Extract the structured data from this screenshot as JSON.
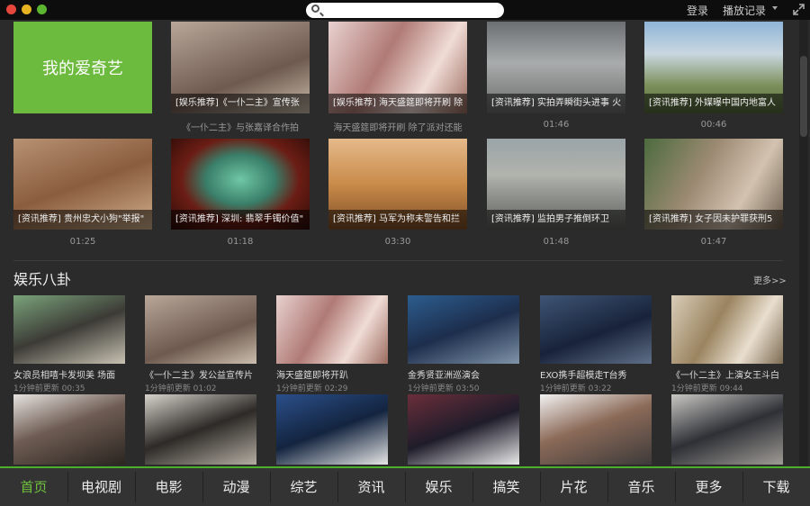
{
  "titlebar": {
    "search_placeholder": "",
    "login": "登录",
    "history": "播放记录"
  },
  "brand": {
    "label": "我的爱奇艺"
  },
  "row1": [
    {
      "caption": "[娱乐推荐]《一仆二主》宣传张",
      "meta": "《一仆二主》与张嘉译合作拍",
      "bg": "linear-gradient(160deg,#b9a79a,#6e5a4f 60%,#ccbfae)"
    },
    {
      "caption": "[娱乐推荐] 海天盛筵即将开刷 除",
      "meta": "海天盛筵即将开刷 除了派对还能",
      "bg": "linear-gradient(120deg,#e8d2d0,#b07a75 40%,#f0dcd6 70%,#9b6b5e)"
    },
    {
      "caption": "[资讯推荐] 实拍弄瞬街头进事 火",
      "meta": "01:46",
      "bg": "linear-gradient(180deg,#6b6f72,#a9acac 45%,#6a6b6a)"
    },
    {
      "caption": "[资讯推荐] 外媒曝中国内地富人",
      "meta": "00:46",
      "bg": "linear-gradient(180deg,#8fb5d8,#c9d7e0 35%,#7b8f5a 70%,#566a3c)"
    }
  ],
  "row2": [
    {
      "caption": "[资讯推荐] 贵州忠犬小狗\"举报\"",
      "meta": "01:25",
      "bg": "linear-gradient(160deg,#b79273,#8a5d3e 50%,#d1b08c)"
    },
    {
      "caption": "[资讯推荐] 深圳: 翡翠手镯价值\"",
      "meta": "01:18",
      "bg": "radial-gradient(ellipse at 50% 45%,#6fc7a5,#3a7e69 35%,#6b1d14 60%,#2a0b07)"
    },
    {
      "caption": "[资讯推荐] 马军为称未警告和拦",
      "meta": "03:30",
      "bg": "linear-gradient(180deg,#e5b98a,#c98b4a 50%,#7f4d25)"
    },
    {
      "caption": "[资讯推荐] 监拍男子推倒环卫",
      "meta": "01:48",
      "bg": "linear-gradient(180deg,#9aa4a8,#b1b3ad 40%,#5b5e5a)"
    },
    {
      "caption": "[资讯推荐] 女子因未护罪获刑5",
      "meta": "01:47",
      "bg": "linear-gradient(120deg,#4c6b3e,#9c8a73 40%,#d3c2b0 70%,#6a5c4b)"
    }
  ],
  "section": {
    "title": "娱乐八卦",
    "more": "更多>>"
  },
  "small_row1": [
    {
      "title": "女浪员相嘻卡发坝美 场面",
      "meta": "1分钟前更新 00:35",
      "bg": "linear-gradient(160deg,#7aa37a,#3c3b36 50%,#c8c2b2)"
    },
    {
      "title": "《一仆二主》发公益宣传片",
      "meta": "1分钟前更新 01:02",
      "bg": "linear-gradient(160deg,#b9a79a,#6e5a4f 60%,#ccbfae)"
    },
    {
      "title": "海天盛筵即将开趴",
      "meta": "1分钟前更新 02:29",
      "bg": "linear-gradient(120deg,#e8d2d0,#b07a75 40%,#f0dcd6 70%,#9b6b5e)"
    },
    {
      "title": "金秀贤亚洲巡演会",
      "meta": "1分钟前更新 03:50",
      "bg": "linear-gradient(160deg,#2c5d8e,#1d2e4d 50%,#7f93a8)"
    },
    {
      "title": "EXO携手超模走T台秀",
      "meta": "1分钟前更新 03:22",
      "bg": "linear-gradient(160deg,#3e5575,#18233a 55%,#5f6f88)"
    },
    {
      "title": "《一仆二主》上演女王斗白",
      "meta": "1分钟前更新 09:44",
      "bg": "linear-gradient(120deg,#d9cdb8,#9a8460 40%,#e9dfcf 70%,#7d6b52)"
    }
  ],
  "small_row2": [
    {
      "bg": "linear-gradient(160deg,#e6e3e0,#6e5c53 45%,#2a2520)"
    },
    {
      "bg": "linear-gradient(160deg,#d7d3cc,#2d2a27 50%,#b4ada2)"
    },
    {
      "bg": "linear-gradient(160deg,#2b4f8a,#13243f 50%,#e6e6e6)"
    },
    {
      "bg": "linear-gradient(160deg,#6a2e3a,#1f1c2a 50%,#e9e9e9)"
    },
    {
      "bg": "linear-gradient(160deg,#f2f2f2,#8b6a58 45%,#3d3a3a)"
    },
    {
      "bg": "linear-gradient(160deg,#c9c7c3,#2e3036 50%,#9f9b95)"
    }
  ],
  "nav": [
    "首页",
    "电视剧",
    "电影",
    "动漫",
    "综艺",
    "资讯",
    "娱乐",
    "搞笑",
    "片花",
    "音乐",
    "更多",
    "下载"
  ],
  "colors": {
    "accent": "#4caf2b",
    "brand_tile": "#6dbb3e"
  }
}
